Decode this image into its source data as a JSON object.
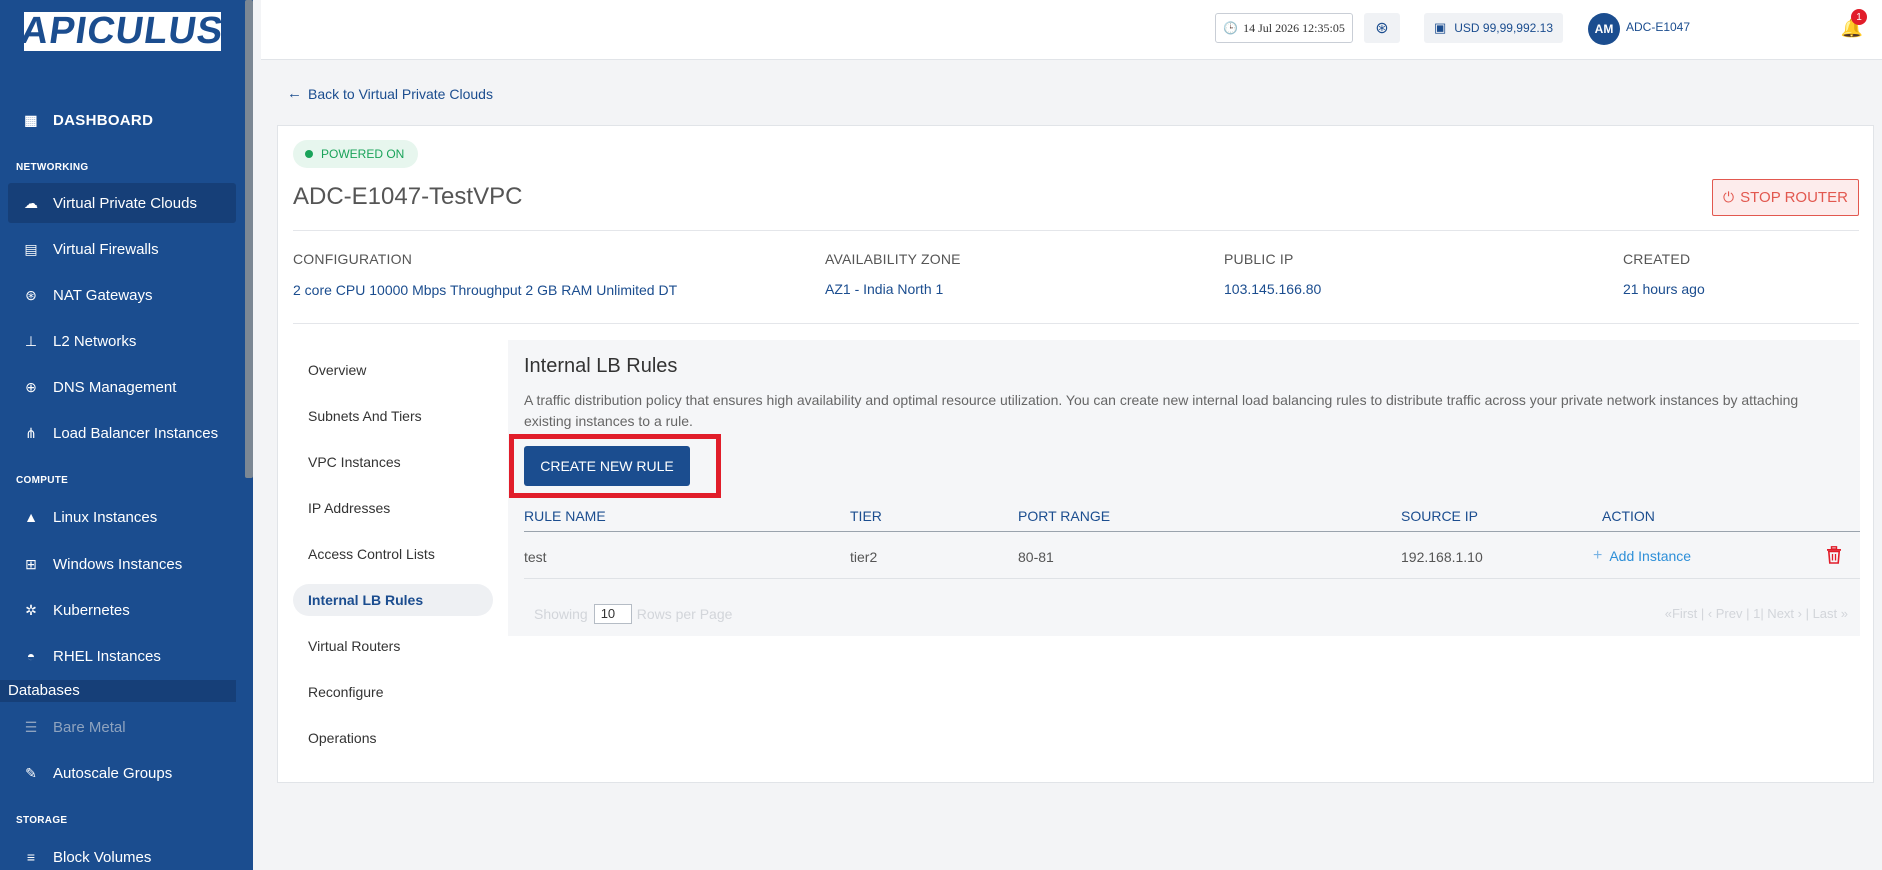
{
  "brand": {
    "logo_text": "APICULUS"
  },
  "sidebar": {
    "dashboard": "DASHBOARD",
    "sections": {
      "networking": "NETWORKING",
      "compute": "COMPUTE",
      "storage": "STORAGE"
    },
    "networking_items": [
      {
        "label": "Virtual Private Clouds",
        "icon": "cloud-icon",
        "active": true
      },
      {
        "label": "Virtual Firewalls",
        "icon": "firewall-icon"
      },
      {
        "label": "NAT Gateways",
        "icon": "gateway-icon"
      },
      {
        "label": "L2 Networks",
        "icon": "network-icon"
      },
      {
        "label": "DNS Management",
        "icon": "globe-icon"
      },
      {
        "label": "Load Balancer Instances",
        "icon": "load-balancer-icon"
      }
    ],
    "compute_items": [
      {
        "label": "Linux Instances",
        "icon": "linux-icon"
      },
      {
        "label": "Windows Instances",
        "icon": "windows-icon"
      },
      {
        "label": "Kubernetes",
        "icon": "kubernetes-icon"
      },
      {
        "label": "RHEL Instances",
        "icon": "rhel-icon"
      }
    ],
    "databases": "Databases",
    "bare_metal": "Bare Metal",
    "autoscale": "Autoscale Groups",
    "block_volumes": "Block Volumes"
  },
  "topbar": {
    "datetime": "14 Jul 2026 12:35:05",
    "balance": "USD 99,99,992.13",
    "avatar_initials": "AM",
    "username": "ADC-E1047",
    "notification_count": "1"
  },
  "back_link": "Back to Virtual Private Clouds",
  "vpc": {
    "status": "POWERED ON",
    "name": "ADC-E1047-TestVPC",
    "stop_label": "STOP ROUTER",
    "info": [
      {
        "label": "CONFIGURATION",
        "value": "2 core CPU 10000 Mbps Throughput 2 GB RAM Unlimited DT"
      },
      {
        "label": "AVAILABILITY ZONE",
        "value": "AZ1 - India North 1"
      },
      {
        "label": "PUBLIC IP",
        "value": "103.145.166.80"
      },
      {
        "label": "CREATED",
        "value": "21 hours ago"
      }
    ]
  },
  "tabs": [
    "Overview",
    "Subnets And Tiers",
    "VPC Instances",
    "IP Addresses",
    "Access Control Lists",
    "Internal LB Rules",
    "Virtual Routers",
    "Reconfigure",
    "Operations"
  ],
  "active_tab": "Internal LB Rules",
  "panel": {
    "title": "Internal LB Rules",
    "description": "A traffic distribution policy that ensures high availability and optimal resource utilization. You can create new internal load balancing rules to distribute traffic across your private network instances by attaching existing instances to a rule.",
    "create_label": "CREATE NEW RULE",
    "columns": [
      "RULE NAME",
      "TIER",
      "PORT RANGE",
      "SOURCE IP",
      "ACTION"
    ],
    "rows": [
      {
        "rule_name": "test",
        "tier": "tier2",
        "port_range": "80-81",
        "source_ip": "192.168.1.10",
        "action": "Add Instance"
      }
    ],
    "pager": {
      "showing": "Showing",
      "rows_value": "10",
      "rows_per_page": "Rows per Page",
      "nav": "«First  |  ‹ Prev  |  1|  Next ›  |  Last »"
    }
  },
  "colors": {
    "sidebar": "#1b4d8f",
    "accent": "#1b4d8f",
    "danger": "#e11d2a",
    "success": "#1aa35a"
  }
}
